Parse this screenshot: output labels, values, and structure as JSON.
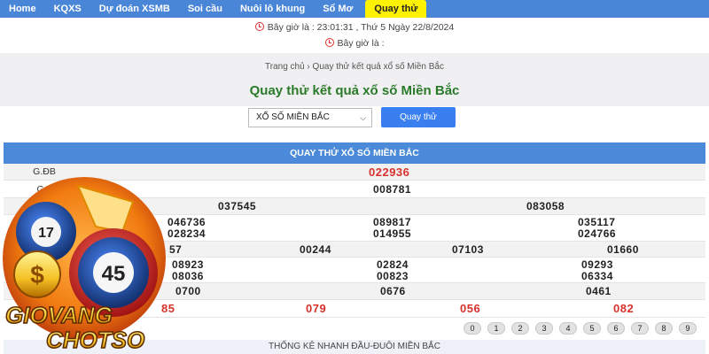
{
  "nav": {
    "items": [
      "Home",
      "KQXS",
      "Dự đoán XSMB",
      "Soi cầu",
      "Nuôi lô khung",
      "Sổ Mơ"
    ],
    "active_item": "Quay thử"
  },
  "clock": {
    "now_text": "Bây giờ là : 23:01:31 , Thứ 5 Ngày 22/8/2024",
    "second_text": "Bây giờ là :"
  },
  "breadcrumb": "Trang chủ › Quay thử kết quả xổ số Miền Bắc",
  "title": "Quay thử kết quả xổ số Miền Bắc",
  "form": {
    "select_value": "XỔ SỐ MIỀN BẮC",
    "button_label": "Quay thử"
  },
  "table": {
    "header": "QUAY THỬ XỔ SỐ MIỀN BẮC",
    "labels": {
      "db": "G.ĐB",
      "g1": "G.1"
    },
    "gdb": "022936",
    "g1": "008781",
    "g2": [
      "037545",
      "083058"
    ],
    "g3": [
      "046736",
      "089817",
      "035117",
      "028234",
      "014955",
      "024766"
    ],
    "g4": [
      "57",
      "00244",
      "07103",
      "01660"
    ],
    "g5": [
      "08923",
      "02824",
      "09293",
      "08036",
      "00823",
      "06334"
    ],
    "g6": [
      "0700",
      "0676",
      "0461"
    ],
    "g7": [
      "85",
      "079",
      "056",
      "082"
    ]
  },
  "digits": [
    "0",
    "1",
    "2",
    "3",
    "4",
    "5",
    "6",
    "7",
    "8",
    "9"
  ],
  "stats_title": "THỐNG KÊ NHANH ĐẦU-ĐUÔI MIỀN BẮC",
  "logo": {
    "balls": [
      "17",
      "45"
    ],
    "line1": "GIOVANG",
    "line2": "CHOTSO"
  },
  "colors": {
    "nav_bg": "#4a86d8",
    "active_tab": "#fff200",
    "title_green": "#2a7a2a",
    "prize_red": "#d8322c",
    "button_blue": "#3a7ff0"
  }
}
